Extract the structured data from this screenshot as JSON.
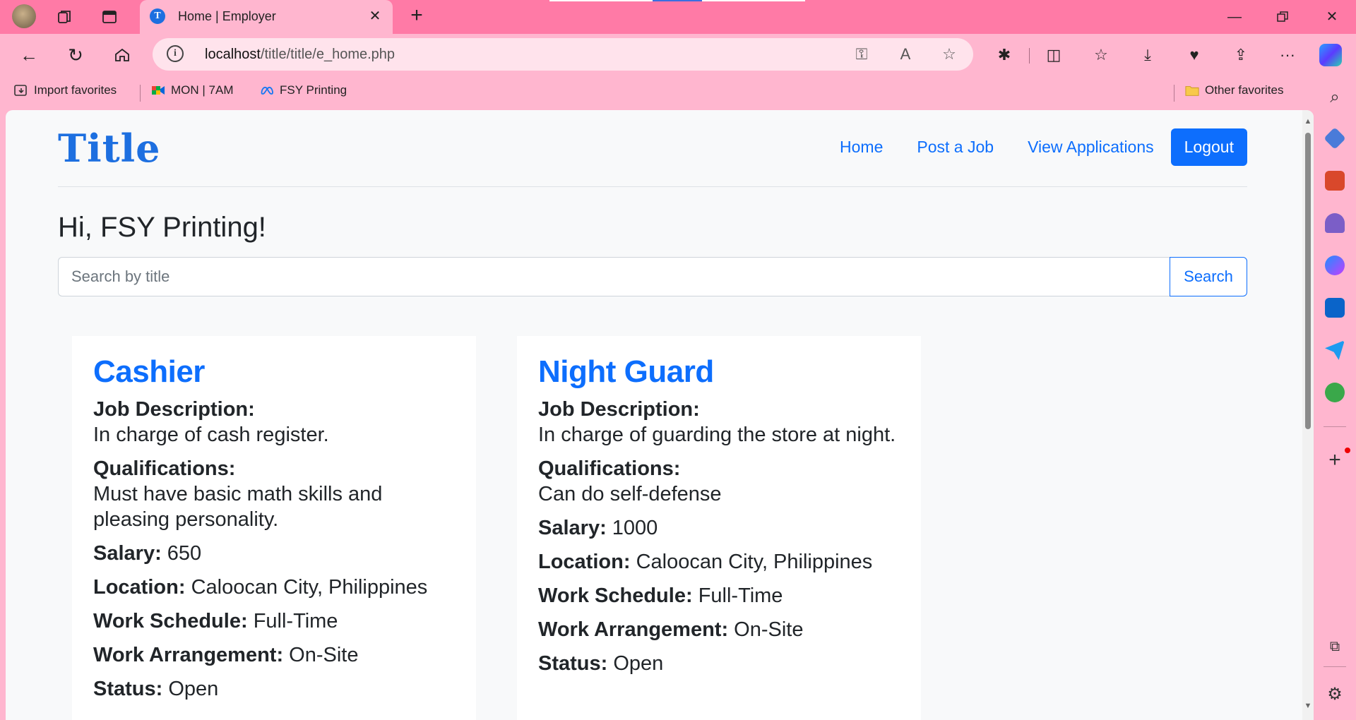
{
  "browser": {
    "tab_title": "Home | Employer",
    "url_host": "localhost",
    "url_path": "/title/title/e_home.php",
    "bookmarks": {
      "import": "Import favorites",
      "item1": "MON | 7AM",
      "item2": "FSY Printing",
      "other": "Other favorites"
    }
  },
  "site": {
    "brand": "Title",
    "nav": {
      "home": "Home",
      "post_job": "Post a Job",
      "view_applications": "View Applications",
      "logout": "Logout"
    },
    "greeting": "Hi, FSY Printing!",
    "search": {
      "placeholder": "Search by title",
      "button": "Search"
    }
  },
  "labels": {
    "job_description": "Job Description:",
    "qualifications": "Qualifications:",
    "salary": "Salary:",
    "location": "Location:",
    "work_schedule": "Work Schedule:",
    "work_arrangement": "Work Arrangement:",
    "status": "Status:"
  },
  "jobs": [
    {
      "title": "Cashier",
      "description": "In charge of cash register.",
      "qualifications": "Must have basic math skills and pleasing personality.",
      "salary": "650",
      "location": "Caloocan City, Philippines",
      "work_schedule": "Full-Time",
      "work_arrangement": "On-Site",
      "status": "Open"
    },
    {
      "title": "Night Guard",
      "description": "In charge of guarding the store at night.",
      "qualifications": "Can do self-defense",
      "salary": "1000",
      "location": "Caloocan City, Philippines",
      "work_schedule": "Full-Time",
      "work_arrangement": "On-Site",
      "status": "Open"
    }
  ],
  "colors": {
    "chrome": "#ff7aa6",
    "chrome_light": "#ffb6cf",
    "primary": "#0d6efd",
    "danger": "#dc3545"
  }
}
